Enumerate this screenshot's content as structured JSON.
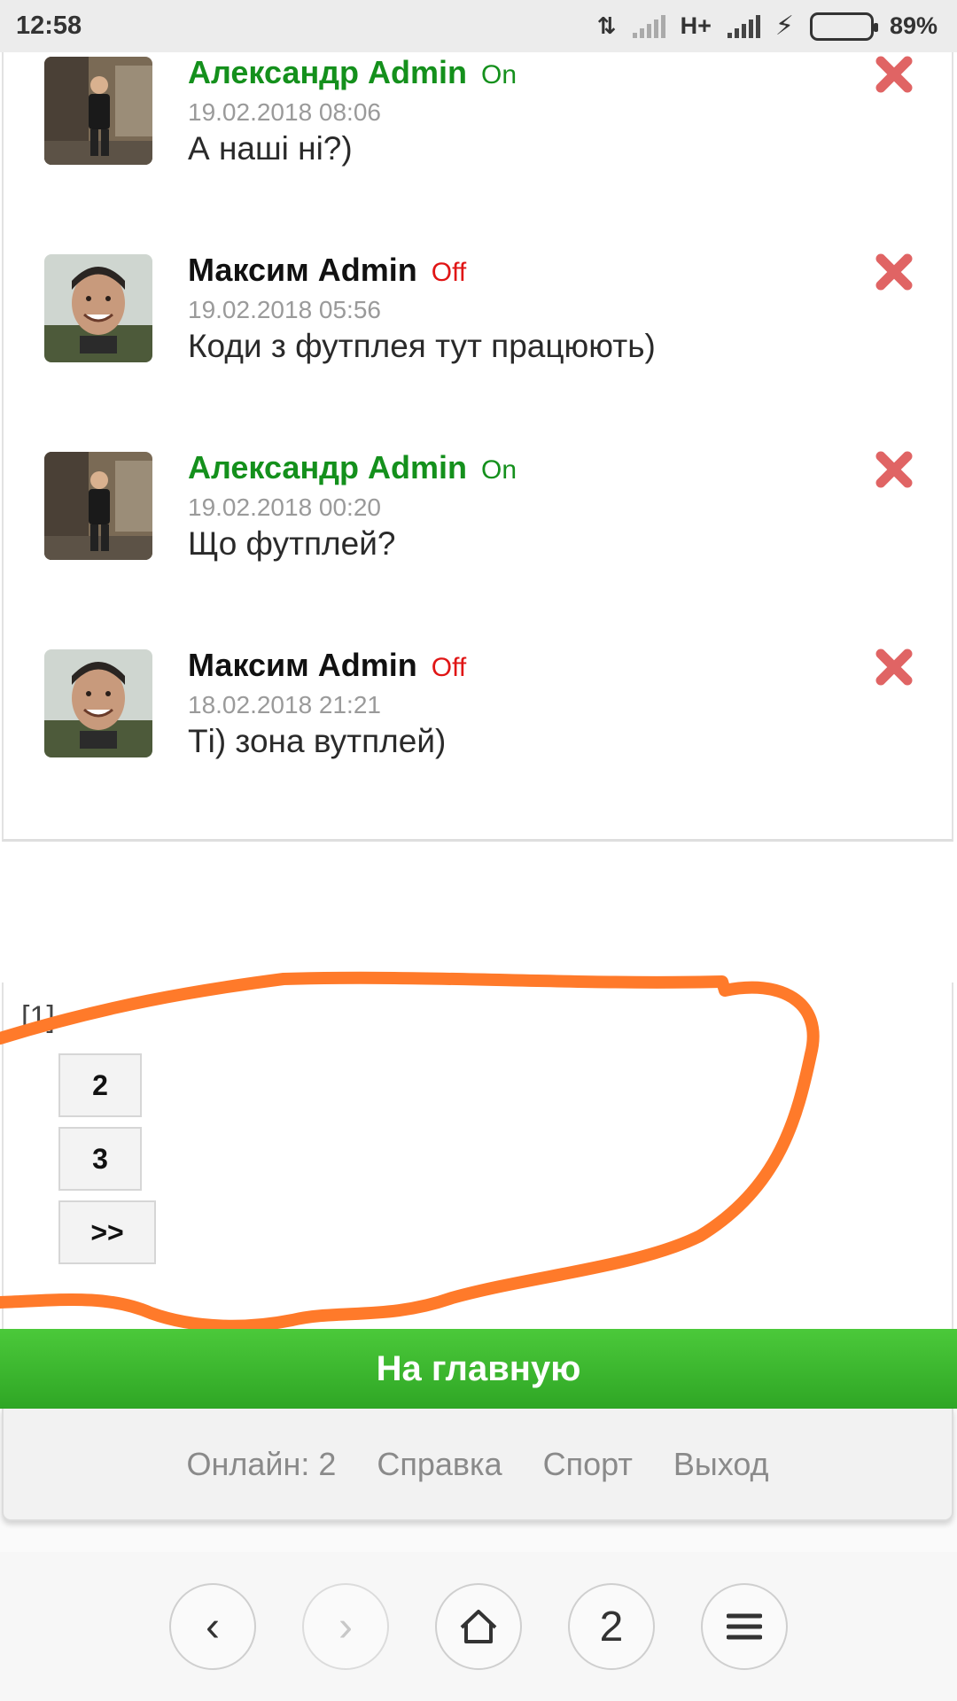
{
  "status_bar": {
    "time": "12:58",
    "network": "H+",
    "battery": "89%"
  },
  "messages": [
    {
      "author": "Александр Admin",
      "author_color": "#14901c",
      "status": "On",
      "date": "19.02.2018 08:06",
      "text": "А наші ні?)",
      "avatar": "photo-man-workshop"
    },
    {
      "author": "Максим Admin",
      "author_color": "#111111",
      "status": "Off",
      "date": "19.02.2018 05:56",
      "text": "Коди з футплея тут працюють)",
      "avatar": "photo-man-smiling"
    },
    {
      "author": "Александр Admin",
      "author_color": "#14901c",
      "status": "On",
      "date": "19.02.2018 00:20",
      "text": "Що футплей?",
      "avatar": "photo-man-workshop"
    },
    {
      "author": "Максим Admin",
      "author_color": "#111111",
      "status": "Off",
      "date": "18.02.2018 21:21",
      "text": "Ті) зона вутплей)",
      "avatar": "photo-man-smiling"
    }
  ],
  "pagination": {
    "current": "[1]",
    "pages": [
      "2",
      "3"
    ],
    "next": ">>"
  },
  "home_button": "На главную",
  "footer": {
    "online": "Онлайн: 2",
    "help": "Справка",
    "sport": "Спорт",
    "logout": "Выход"
  },
  "browser_nav": {
    "tab_count": "2"
  },
  "colors": {
    "accent_green": "#3cb52d",
    "online_green": "#14901c",
    "offline_red": "#e01515",
    "scribble_orange": "#ff7a2a"
  }
}
